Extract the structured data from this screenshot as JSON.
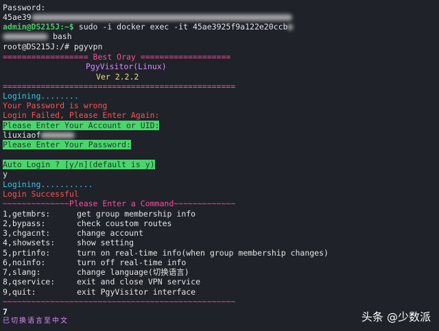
{
  "colors": {
    "background": "#1f2229",
    "default_text": "#e6e6e6",
    "prompt_green": "#4ec96a",
    "pink": "#ff4aa0",
    "magenta": "#d98cff",
    "yellow": "#f2e272",
    "cyan": "#38c7e6",
    "red": "#ff5151",
    "highlight_bg": "#4ad66d",
    "highlight_fg": "#1b3a25"
  },
  "password_block": {
    "label": "Password:",
    "value_prefix": "45ae39"
  },
  "docker_cmd": {
    "prompt": "admin@DS215J:~$",
    "command": " sudo -i docker exec -it 45ae3925f9a122e20ccb",
    "tail": "bash"
  },
  "root_prompt": {
    "prompt": "root@DS215J:/#",
    "command": " pgyvpn"
  },
  "banner": {
    "top": "================== Best Oray ===================",
    "name": "PgyVisitor(Linux)",
    "version": "Ver 2.2.2",
    "bottom": "================================================="
  },
  "login_attempt_1": {
    "logining": "Logining........",
    "wrong_password": "Your Password is wrong",
    "login_failed": "Login Failed, Please Enter Again:",
    "enter_account": "Please Enter Your Account or UID:",
    "account_prefix": "liuxiaof",
    "enter_password": "Please Enter Your Password:"
  },
  "auto_login": {
    "question": "Auto Login ? [y/n](default is y)",
    "answer": "y"
  },
  "login_attempt_2": {
    "logining": "Logining...........",
    "success": "Login Successful"
  },
  "menu": {
    "header": "~~~~~~~~~~~~~~Please Enter a Command~~~~~~~~~~~~~",
    "footer": "~~~~~~~~~~~~~~~~~~~~~~~~~~~~~~~~~~~~~~~~~~~~~~~~~",
    "items": [
      {
        "cmd": "1,getmbrs:",
        "desc": "get group membership info"
      },
      {
        "cmd": "2,bypass:",
        "desc": "check coustom routes"
      },
      {
        "cmd": "3,chgacnt:",
        "desc": "change account"
      },
      {
        "cmd": "4,showsets:",
        "desc": "show setting"
      },
      {
        "cmd": "5,prtinfo:",
        "desc": "turn on real-time info(when group membership changes)"
      },
      {
        "cmd": "6,noinfo:",
        "desc": "turn off real-time info"
      },
      {
        "cmd": "7,slang:",
        "desc": "change language(切换语言)"
      },
      {
        "cmd": "8,qservice:",
        "desc": "exit and close VPN service"
      },
      {
        "cmd": "9,quit:",
        "desc": "exit PgyVisitor interface"
      }
    ]
  },
  "user_input": "7",
  "switched_msg": "已切换语言至中文",
  "watermark": "头条 @少数派"
}
